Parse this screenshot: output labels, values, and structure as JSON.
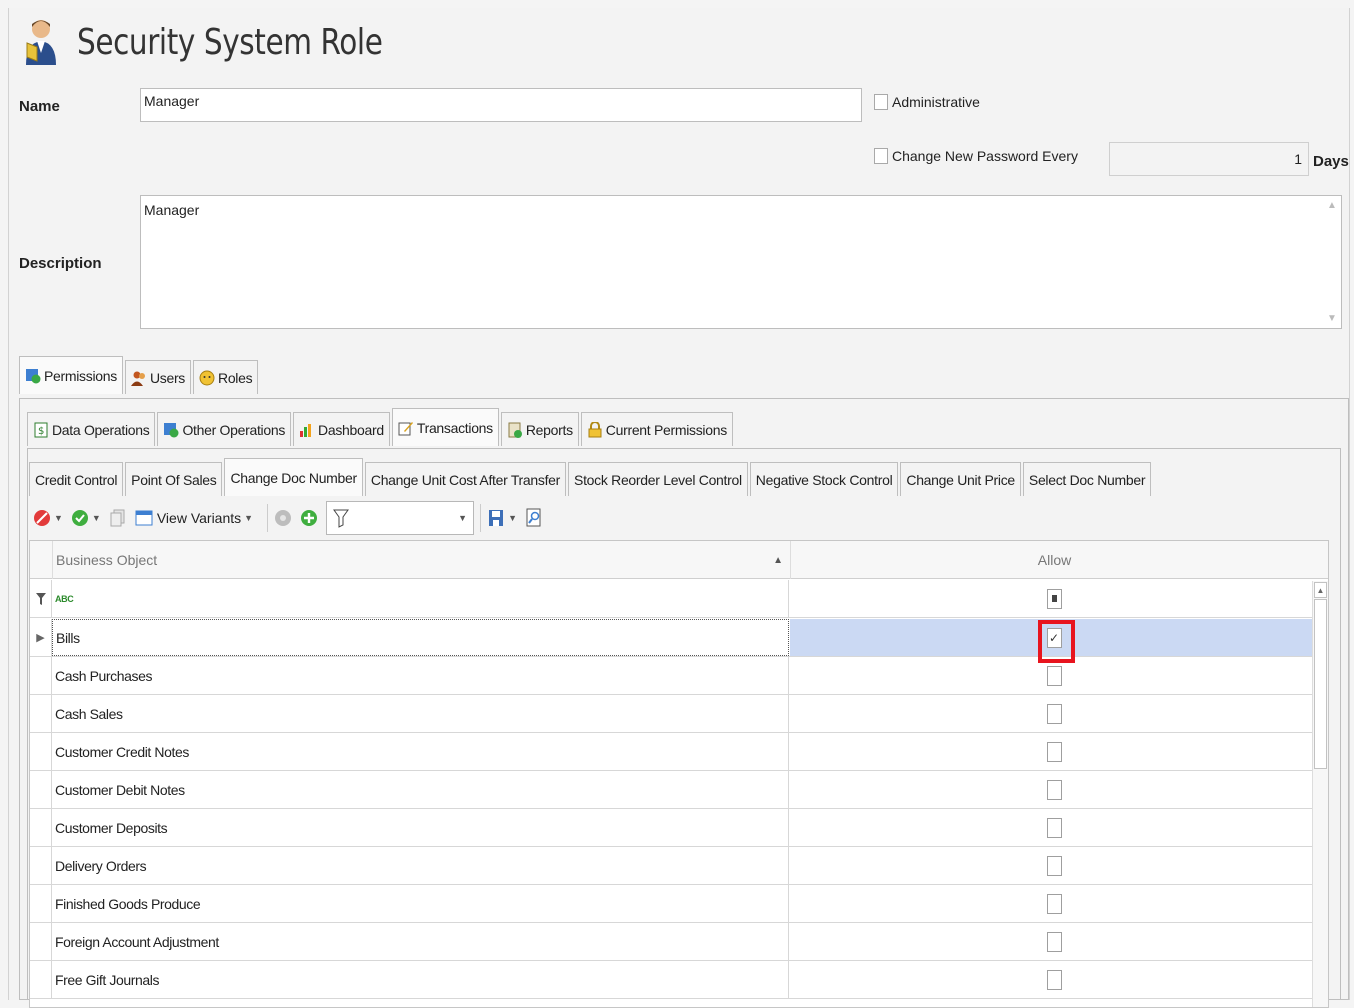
{
  "header": {
    "title": "Security System Role",
    "icon": "user-security-icon"
  },
  "form": {
    "name_label": "Name",
    "name_value": "Manager",
    "administrative_label": "Administrative",
    "change_password_label": "Change New Password Every",
    "password_days_value": "1",
    "days_label": "Days",
    "description_label": "Description",
    "description_value": "Manager"
  },
  "main_tabs": [
    {
      "label": "Permissions",
      "icon": "permissions-icon"
    },
    {
      "label": "Users",
      "icon": "users-icon"
    },
    {
      "label": "Roles",
      "icon": "roles-icon"
    }
  ],
  "sub_tabs": [
    {
      "label": "Data Operations",
      "icon": "dollar-icon"
    },
    {
      "label": "Other Operations",
      "icon": "operations-icon"
    },
    {
      "label": "Dashboard",
      "icon": "chart-icon"
    },
    {
      "label": "Transactions",
      "icon": "edit-icon"
    },
    {
      "label": "Reports",
      "icon": "report-icon"
    },
    {
      "label": "Current Permissions",
      "icon": "lock-icon"
    }
  ],
  "trans_tabs": [
    {
      "label": "Credit Control"
    },
    {
      "label": "Point Of Sales"
    },
    {
      "label": "Change Doc Number"
    },
    {
      "label": "Change Unit Cost After Transfer"
    },
    {
      "label": "Stock Reorder Level Control"
    },
    {
      "label": "Negative Stock Control"
    },
    {
      "label": "Change Unit Price"
    },
    {
      "label": "Select Doc Number"
    }
  ],
  "toolbar": {
    "view_variants_label": "View Variants"
  },
  "grid": {
    "columns": {
      "business_object": "Business Object",
      "allow": "Allow"
    },
    "filter_row_text": "ABC",
    "rows": [
      {
        "name": "Bills",
        "checked": true
      },
      {
        "name": "Cash Purchases",
        "checked": false
      },
      {
        "name": "Cash Sales",
        "checked": false
      },
      {
        "name": "Customer Credit Notes",
        "checked": false
      },
      {
        "name": "Customer Debit Notes",
        "checked": false
      },
      {
        "name": "Customer Deposits",
        "checked": false
      },
      {
        "name": "Delivery Orders",
        "checked": false
      },
      {
        "name": "Finished Goods Produce",
        "checked": false
      },
      {
        "name": "Foreign Account Adjustment",
        "checked": false
      },
      {
        "name": "Free Gift Journals",
        "checked": false
      }
    ]
  },
  "colors": {
    "selection": "#cbd9f3",
    "highlight": "#e8141e"
  }
}
